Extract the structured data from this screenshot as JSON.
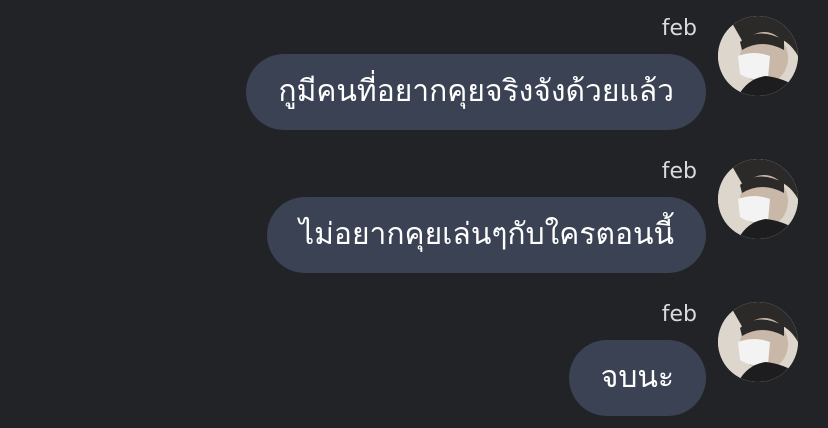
{
  "messages": [
    {
      "sender": "feb",
      "text": "กูมีคนที่อยากคุยจริงจังด้วยแล้ว",
      "avatar_icon": "user-photo-icon"
    },
    {
      "sender": "feb",
      "text": "ไม่อยากคุยเล่นๆกับใครตอนนี้",
      "avatar_icon": "user-photo-icon"
    },
    {
      "sender": "feb",
      "text": "จบนะ",
      "avatar_icon": "user-photo-icon"
    }
  ],
  "colors": {
    "background": "#212327",
    "bubble": "#3b4253",
    "text": "#ffffff",
    "sender": "#d9dadd"
  }
}
